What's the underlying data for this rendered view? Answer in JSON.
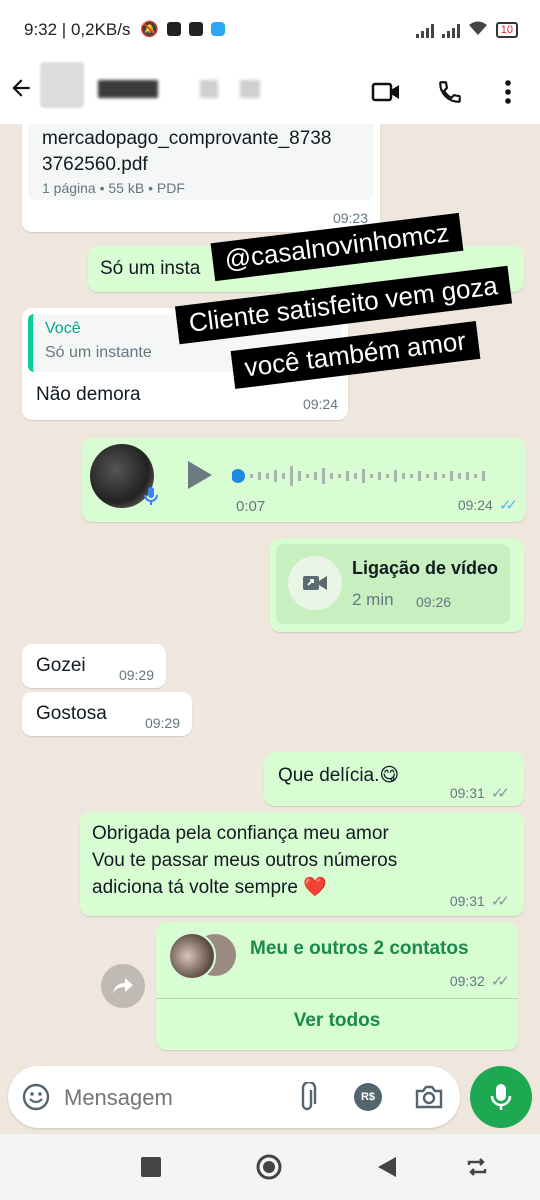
{
  "status": {
    "time": "9:32 | 0,2KB/s",
    "battery": "10"
  },
  "messages": {
    "file": {
      "name_line1": "mercadopago_comprovante_8738",
      "name_line2": "3762560.pdf",
      "info": "1 página • 55 kB • PDF",
      "time": "09:23"
    },
    "out1": {
      "text": "Só um insta",
      "time": "09:24"
    },
    "reply": {
      "quote_author": "Você",
      "quote_text": "Só um instante",
      "text": "Não demora",
      "time": "09:24"
    },
    "voice": {
      "duration": "0:07",
      "time": "09:24"
    },
    "call": {
      "title": "Ligação de vídeo",
      "duration": "2 min",
      "time": "09:26"
    },
    "in1": {
      "text": "Gozei",
      "time": "09:29"
    },
    "in2": {
      "text": "Gostosa",
      "time": "09:29"
    },
    "out2": {
      "text": "Que delícia.😋",
      "time": "09:31"
    },
    "out3": {
      "line1": "Obrigada pela confiança meu amor",
      "line2": "Vou te passar meus outros números",
      "line3": "adiciona tá volte sempre ❤️",
      "time": "09:31"
    },
    "contacts": {
      "title": "Meu e outros 2 contatos",
      "time": "09:32",
      "button": "Ver todos"
    }
  },
  "overlay": {
    "line1": "@casalnovinhomcz",
    "line2": "Cliente satisfeito vem goza",
    "line3": "você também amor"
  },
  "input": {
    "placeholder": "Mensagem"
  },
  "colors": {
    "accent": "#1da851",
    "out_bubble": "#d9fdd3",
    "chat_bg": "#efe7de",
    "tick_blue": "#53bdeb"
  }
}
